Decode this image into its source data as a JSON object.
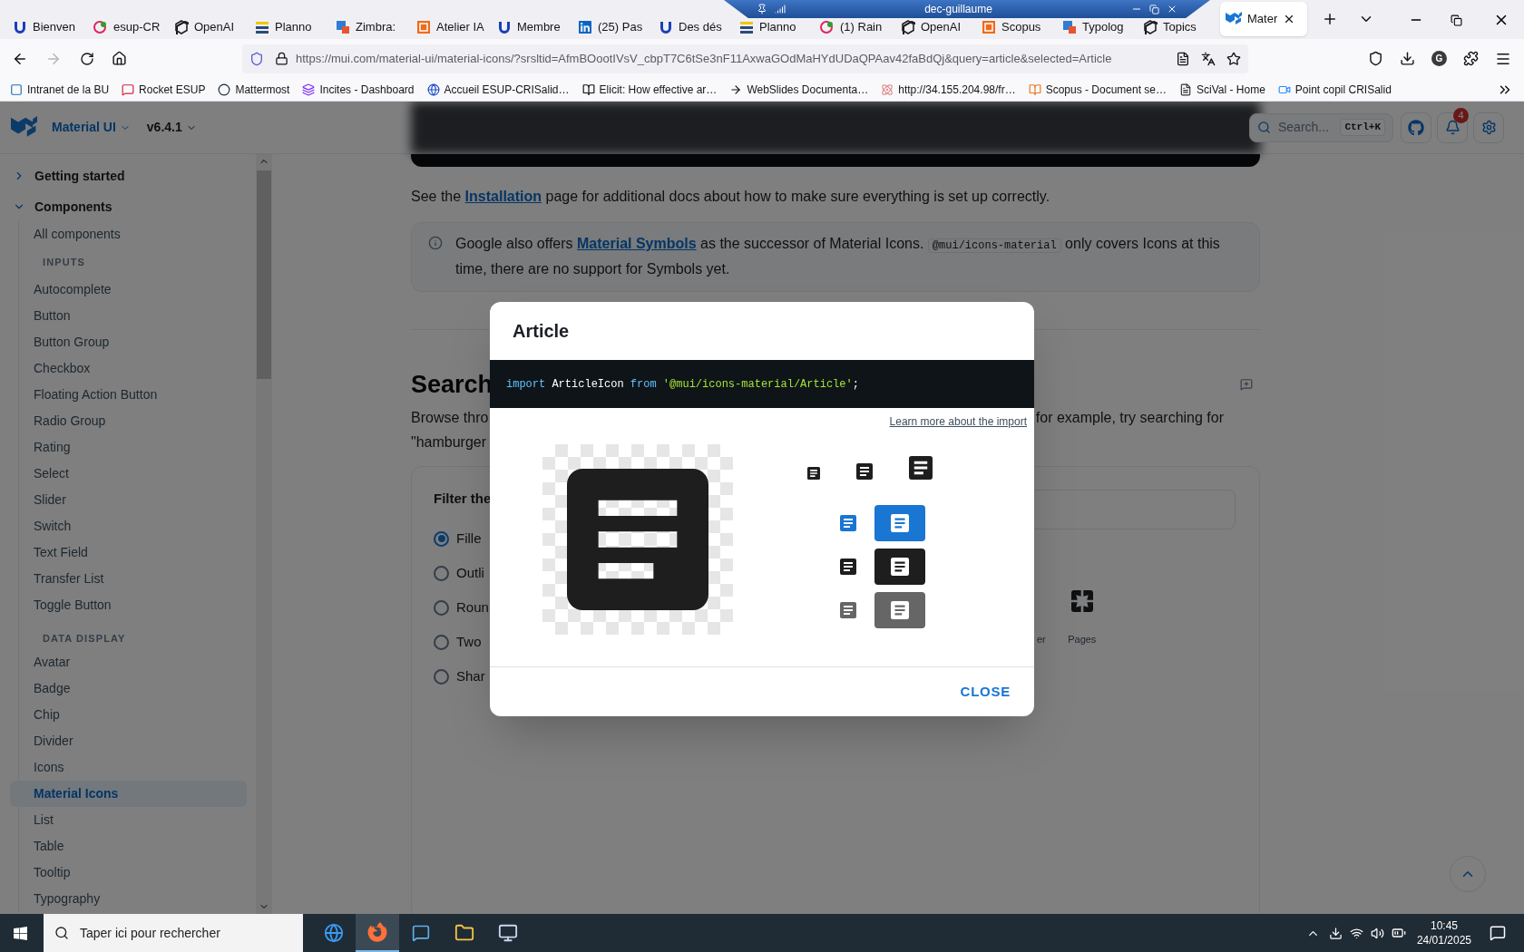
{
  "browser": {
    "tabs": [
      {
        "label": "Bienven",
        "selected": false
      },
      {
        "label": "esup-CR",
        "selected": false
      },
      {
        "label": "OpenAI",
        "selected": false
      },
      {
        "label": "Planno",
        "selected": false
      },
      {
        "label": "Zimbra:",
        "selected": false
      },
      {
        "label": "Atelier IA",
        "selected": false
      },
      {
        "label": "Membre",
        "selected": false
      },
      {
        "label": "(25) Pas",
        "selected": false
      },
      {
        "label": "Des dés",
        "selected": false
      },
      {
        "label": "Planno",
        "selected": false
      },
      {
        "label": "(1) Rain",
        "selected": false
      },
      {
        "label": "OpenAI",
        "selected": false
      },
      {
        "label": "Scopus",
        "selected": false
      },
      {
        "label": "Typolog",
        "selected": false
      },
      {
        "label": "Topics",
        "selected": false
      },
      {
        "label": "Mater",
        "selected": true
      }
    ],
    "remote_bar": {
      "title": "dec-guillaume"
    },
    "url": "https://mui.com/material-ui/material-icons/?srsltid=AfmBOootIVsV_cbpT7C6tSe3nF11AxwaGOdMaHYdUDaQPAav42faBdQj&query=article&selected=Article",
    "account_initial": "G",
    "bookmarks": [
      "Intranet de la BU",
      "Rocket ESUP",
      "Mattermost",
      "Incites - Dashboard",
      "Accueil ESUP-CRISalid…",
      "Elicit: How effective ar…",
      "WebSlides Documenta…",
      "http://34.155.204.98/fr…",
      "Scopus - Document se…",
      "SciVal - Home",
      "Point copil CRISalid"
    ]
  },
  "site_header": {
    "brand": "Material UI",
    "version": "v6.4.1",
    "search_placeholder": "Search...",
    "shortcut": "Ctrl+K",
    "notifications": "4"
  },
  "sidebar": {
    "sections": [
      {
        "label": "Getting started",
        "expanded": false
      },
      {
        "label": "Components",
        "expanded": true
      }
    ],
    "top_items": [
      {
        "label": "All components",
        "selected": false
      }
    ],
    "groups": [
      {
        "heading": "INPUTS",
        "items": [
          {
            "label": "Autocomplete",
            "selected": false
          },
          {
            "label": "Button",
            "selected": false
          },
          {
            "label": "Button Group",
            "selected": false
          },
          {
            "label": "Checkbox",
            "selected": false
          },
          {
            "label": "Floating Action Button",
            "selected": false
          },
          {
            "label": "Radio Group",
            "selected": false
          },
          {
            "label": "Rating",
            "selected": false
          },
          {
            "label": "Select",
            "selected": false
          },
          {
            "label": "Slider",
            "selected": false
          },
          {
            "label": "Switch",
            "selected": false
          },
          {
            "label": "Text Field",
            "selected": false
          },
          {
            "label": "Transfer List",
            "selected": false
          },
          {
            "label": "Toggle Button",
            "selected": false
          }
        ]
      },
      {
        "heading": "DATA DISPLAY",
        "items": [
          {
            "label": "Avatar",
            "selected": false
          },
          {
            "label": "Badge",
            "selected": false
          },
          {
            "label": "Chip",
            "selected": false
          },
          {
            "label": "Divider",
            "selected": false
          },
          {
            "label": "Icons",
            "selected": false
          },
          {
            "label": "Material Icons",
            "selected": true
          },
          {
            "label": "List",
            "selected": false
          },
          {
            "label": "Table",
            "selected": false
          },
          {
            "label": "Tooltip",
            "selected": false
          },
          {
            "label": "Typography",
            "selected": false
          }
        ]
      }
    ]
  },
  "content": {
    "install_note": {
      "before": "See the ",
      "link": "Installation",
      "after": " page for additional docs about how to make sure everything is set up correctly."
    },
    "info": {
      "before": "Google also offers ",
      "link": "Material Symbols",
      "middle": " as the successor of Material Icons. ",
      "code": "@mui/icons-material",
      "after": " only covers Icons at this time, there are no support for Symbols yet."
    },
    "search_heading": "Search",
    "browse_left": "Browse thro",
    "browse_right": "for example, try searching for",
    "browse_line2": "\"hamburger",
    "filter_title": "Filter the",
    "styles": [
      {
        "label": "Fille",
        "selected": true
      },
      {
        "label": "Outli",
        "selected": false
      },
      {
        "label": "Roun",
        "selected": false
      },
      {
        "label": "Two",
        "selected": false
      },
      {
        "label": "Shar",
        "selected": false
      }
    ],
    "results": [
      "er",
      "Pages"
    ]
  },
  "modal": {
    "title": "Article",
    "code": [
      {
        "kind": "keyword",
        "text": "import"
      },
      {
        "kind": "plain",
        "text": " ArticleIcon "
      },
      {
        "kind": "keyword",
        "text": "from "
      },
      {
        "kind": "string",
        "text": "'@mui/icons-material/Article'"
      },
      {
        "kind": "plain",
        "text": ";"
      }
    ],
    "learn_link": "Learn more about the import",
    "variants": [
      {
        "color": "#1976d2"
      },
      {
        "color": "#1e1e1e"
      },
      {
        "color": "#666666"
      }
    ],
    "close": "CLOSE"
  },
  "taskbar": {
    "search_placeholder": "Taper ici pour rechercher",
    "time": "10:45",
    "date": "24/01/2025"
  }
}
